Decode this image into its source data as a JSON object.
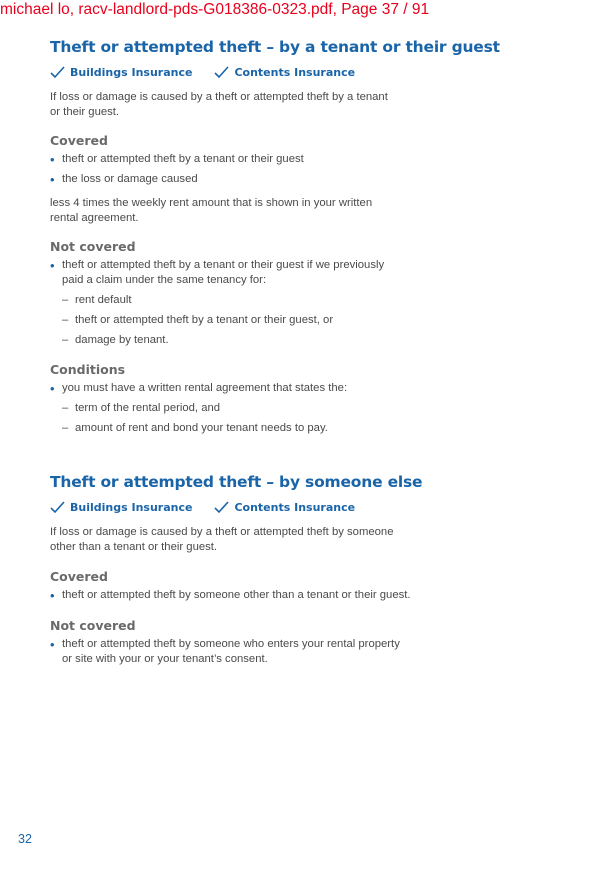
{
  "watermark": "michael lo, racv-landlord-pds-G018386-0323.pdf, Page 37 / 91",
  "colors": {
    "heading_blue": "#1a64a8",
    "watermark_red": "#e8001c",
    "body_text": "#4a4a4a"
  },
  "section1": {
    "title": "Theft or attempted theft – by a tenant or their guest",
    "covers": [
      "Buildings Insurance",
      "Contents Insurance"
    ],
    "intro": [
      "If loss or damage is caused by a theft or attempted theft by a tenant",
      "or their guest."
    ],
    "covered_heading": "Covered",
    "covered_items": [
      "theft or attempted theft by a tenant or their guest",
      "the loss or damage caused"
    ],
    "covered_note": [
      "less 4 times the weekly rent amount that is shown in your written",
      "rental agreement."
    ],
    "not_covered_heading": "Not covered",
    "not_covered_item": [
      "theft or attempted theft by a tenant or their guest if we previously",
      "paid a claim under the same tenancy for:"
    ],
    "not_covered_subitems": [
      "rent default",
      "theft or attempted theft by a tenant or their guest, or",
      "damage by tenant."
    ],
    "conditions_heading": "Conditions",
    "conditions_item": "you must have a written rental agreement that states the:",
    "conditions_subitems": [
      "term of the rental period, and",
      "amount of rent and bond your tenant needs to pay."
    ]
  },
  "section2": {
    "title": "Theft or attempted theft – by someone else",
    "covers": [
      "Buildings Insurance",
      "Contents Insurance"
    ],
    "intro": [
      "If loss or damage is caused by a theft or attempted theft by someone",
      "other than a tenant or their guest."
    ],
    "covered_heading": "Covered",
    "covered_item": "theft or attempted theft by someone other than a tenant or their guest.",
    "not_covered_heading": "Not covered",
    "not_covered_item": [
      "theft or attempted theft by someone who enters your rental property",
      "or site with your or your tenant’s consent."
    ]
  },
  "page_number": "32",
  "icons": {
    "check": "check-icon"
  }
}
